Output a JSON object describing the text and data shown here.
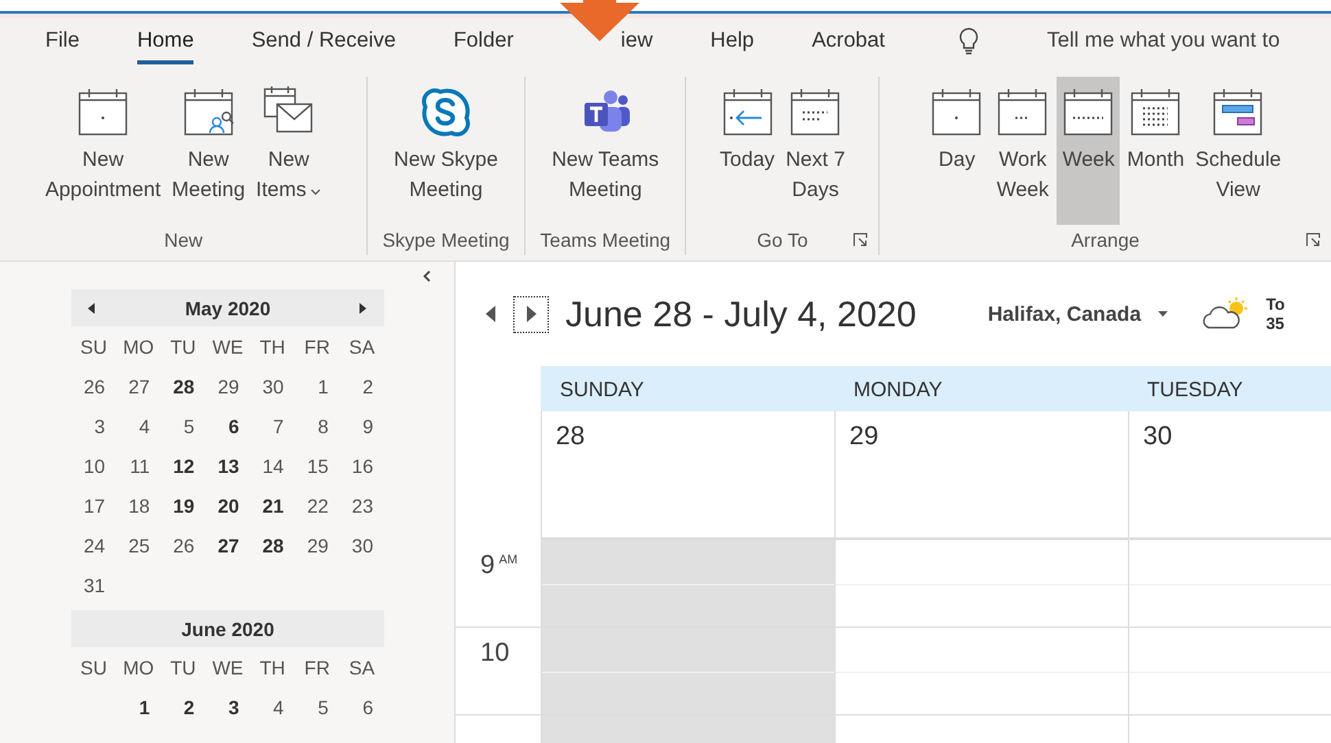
{
  "tabs": [
    {
      "label": "File",
      "selected": false
    },
    {
      "label": "Home",
      "selected": true
    },
    {
      "label": "Send / Receive",
      "selected": false
    },
    {
      "label": "Folder",
      "selected": false
    },
    {
      "label": "iew",
      "selected": false,
      "pointer": true
    },
    {
      "label": "Help",
      "selected": false
    },
    {
      "label": "Acrobat",
      "selected": false
    }
  ],
  "tell_me": "Tell me what you want to",
  "ribbon_groups": [
    {
      "label": "New",
      "launcher": false,
      "buttons": [
        {
          "lines": [
            "New",
            "Appointment"
          ],
          "selected": false
        },
        {
          "lines": [
            "New",
            "Meeting"
          ],
          "selected": false
        },
        {
          "lines": [
            "New",
            "Items"
          ],
          "dropdown": true,
          "selected": false
        }
      ]
    },
    {
      "label": "Skype Meeting",
      "launcher": false,
      "buttons": [
        {
          "lines": [
            "New Skype",
            "Meeting"
          ],
          "selected": false
        }
      ]
    },
    {
      "label": "Teams Meeting",
      "launcher": false,
      "buttons": [
        {
          "lines": [
            "New Teams",
            "Meeting"
          ],
          "selected": false
        }
      ]
    },
    {
      "label": "Go To",
      "launcher": true,
      "buttons": [
        {
          "lines": [
            "Today"
          ],
          "selected": false
        },
        {
          "lines": [
            "Next 7",
            "Days"
          ],
          "selected": false
        }
      ]
    },
    {
      "label": "Arrange",
      "launcher": true,
      "buttons": [
        {
          "lines": [
            "Day"
          ],
          "selected": false
        },
        {
          "lines": [
            "Work",
            "Week"
          ],
          "selected": false
        },
        {
          "lines": [
            "Week"
          ],
          "selected": true
        },
        {
          "lines": [
            "Month"
          ],
          "selected": false
        },
        {
          "lines": [
            "Schedule",
            "View"
          ],
          "selected": false
        }
      ]
    }
  ],
  "mini_calendars": [
    {
      "title": "May 2020",
      "nav": true,
      "weekdays": [
        "SU",
        "MO",
        "TU",
        "WE",
        "TH",
        "FR",
        "SA"
      ],
      "weeks": [
        [
          {
            "day": "26",
            "bold": false
          },
          {
            "day": "27",
            "bold": false
          },
          {
            "day": "28",
            "bold": true
          },
          {
            "day": "29",
            "bold": false
          },
          {
            "day": "30",
            "bold": false
          },
          {
            "day": "1",
            "bold": false
          },
          {
            "day": "2",
            "bold": false
          }
        ],
        [
          {
            "day": "3",
            "bold": false
          },
          {
            "day": "4",
            "bold": false
          },
          {
            "day": "5",
            "bold": false
          },
          {
            "day": "6",
            "bold": true
          },
          {
            "day": "7",
            "bold": false
          },
          {
            "day": "8",
            "bold": false
          },
          {
            "day": "9",
            "bold": false
          }
        ],
        [
          {
            "day": "10",
            "bold": false
          },
          {
            "day": "11",
            "bold": false
          },
          {
            "day": "12",
            "bold": true
          },
          {
            "day": "13",
            "bold": true
          },
          {
            "day": "14",
            "bold": false
          },
          {
            "day": "15",
            "bold": false
          },
          {
            "day": "16",
            "bold": false
          }
        ],
        [
          {
            "day": "17",
            "bold": false
          },
          {
            "day": "18",
            "bold": false
          },
          {
            "day": "19",
            "bold": true
          },
          {
            "day": "20",
            "bold": true
          },
          {
            "day": "21",
            "bold": true
          },
          {
            "day": "22",
            "bold": false
          },
          {
            "day": "23",
            "bold": false
          }
        ],
        [
          {
            "day": "24",
            "bold": false
          },
          {
            "day": "25",
            "bold": false
          },
          {
            "day": "26",
            "bold": false
          },
          {
            "day": "27",
            "bold": true
          },
          {
            "day": "28",
            "bold": true
          },
          {
            "day": "29",
            "bold": false
          },
          {
            "day": "30",
            "bold": false
          }
        ],
        [
          {
            "day": "31",
            "bold": false
          }
        ]
      ]
    },
    {
      "title": "June 2020",
      "nav": false,
      "weekdays": [
        "SU",
        "MO",
        "TU",
        "WE",
        "TH",
        "FR",
        "SA"
      ],
      "weeks": [
        [
          {
            "day": "1",
            "bold": true
          },
          {
            "day": "2",
            "bold": true
          },
          {
            "day": "3",
            "bold": true
          },
          {
            "day": "4",
            "bold": false
          },
          {
            "day": "5",
            "bold": false
          },
          {
            "day": "6",
            "bold": false
          }
        ]
      ]
    }
  ],
  "calendar": {
    "title": "June 28 - July 4, 2020",
    "location": "Halifax, Canada",
    "weather": [
      "To",
      "35"
    ],
    "days": [
      {
        "name": "SUNDAY",
        "date": "28",
        "shaded": true
      },
      {
        "name": "MONDAY",
        "date": "29",
        "shaded": false
      },
      {
        "name": "TUESDAY",
        "date": "30",
        "shaded": false
      }
    ],
    "hours": [
      {
        "hour": "9",
        "suffix": "AM"
      },
      {
        "hour": "10"
      }
    ]
  }
}
